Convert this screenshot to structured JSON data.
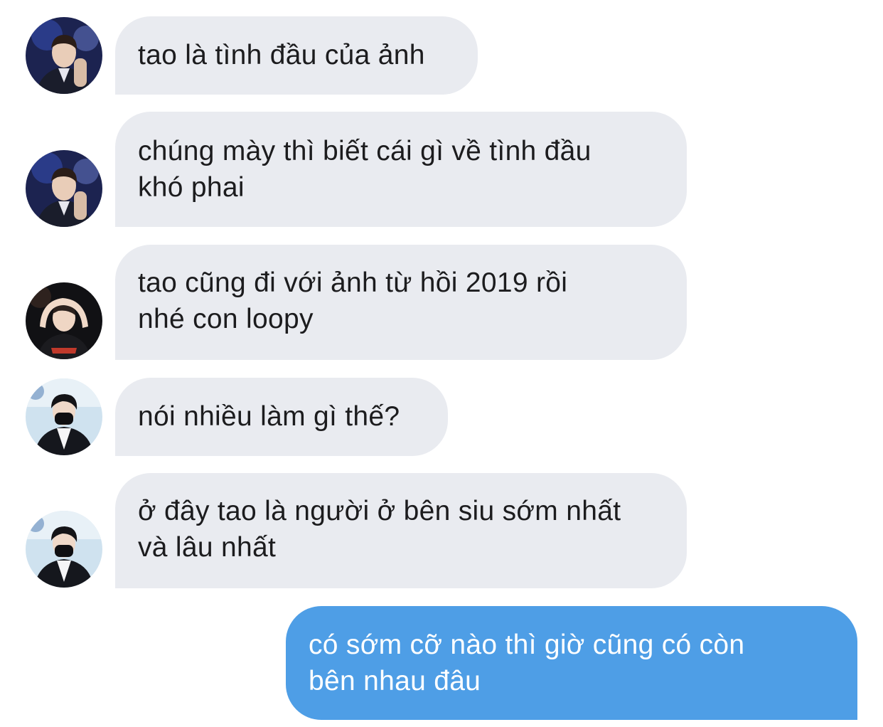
{
  "conversation": {
    "messages": [
      {
        "sender": "other",
        "avatar": "avatar-boy-dark-suit",
        "lines": [
          "tao là tình đầu của ảnh"
        ]
      },
      {
        "sender": "other",
        "avatar": "avatar-boy-dark-suit",
        "lines": [
          "chúng mày thì biết cái gì về tình đầu",
          "khó phai"
        ]
      },
      {
        "sender": "other",
        "avatar": "avatar-boy-hands-on-head",
        "lines": [
          "tao cũng đi với ảnh từ hồi 2019 rồi",
          "nhé con loopy"
        ]
      },
      {
        "sender": "other",
        "avatar": "avatar-boy-black-mask",
        "lines": [
          "nói nhiều làm gì thế?"
        ]
      },
      {
        "sender": "other",
        "avatar": "avatar-boy-black-mask",
        "lines": [
          "ở đây tao là người ở bên siu sớm nhất",
          "và lâu nhất"
        ]
      },
      {
        "sender": "me",
        "lines": [
          "có sớm cỡ nào thì giờ cũng có còn",
          "bên nhau đâu"
        ]
      }
    ]
  },
  "colors": {
    "incoming_bubble": "#e9ebf0",
    "outgoing_bubble": "#4e9ee6",
    "incoming_text": "#1c1c1e",
    "outgoing_text": "#ffffff"
  }
}
